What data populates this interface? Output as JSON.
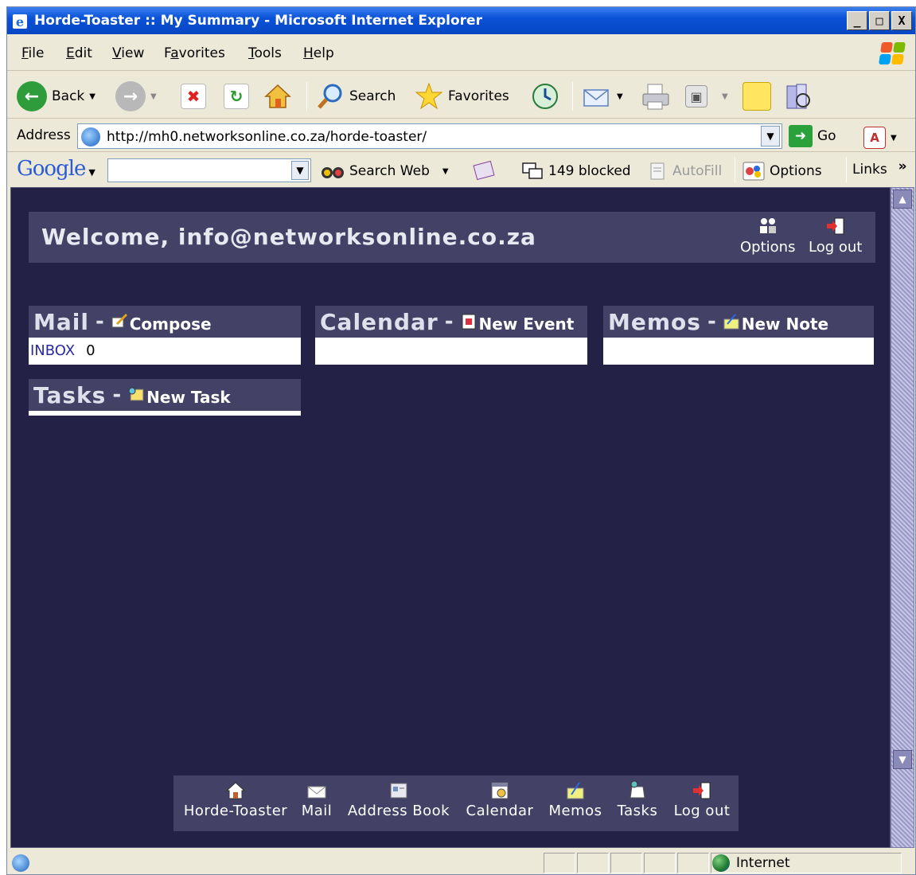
{
  "window": {
    "title": "Horde-Toaster :: My Summary - Microsoft Internet Explorer",
    "buttons": {
      "minimize": "_",
      "maximize": "□",
      "close": "X"
    }
  },
  "menubar": {
    "items": [
      {
        "label": "File",
        "accel": "F",
        "rest": "ile"
      },
      {
        "label": "Edit",
        "accel": "E",
        "rest": "dit"
      },
      {
        "label": "View",
        "accel": "V",
        "rest": "iew"
      },
      {
        "label": "Favorites",
        "pre": "F",
        "accel": "a",
        "rest": "vorites"
      },
      {
        "label": "Tools",
        "accel": "T",
        "rest": "ools"
      },
      {
        "label": "Help",
        "accel": "H",
        "rest": "elp"
      }
    ]
  },
  "toolbar": {
    "back_label": "Back",
    "search_label": "Search",
    "favorites_label": "Favorites"
  },
  "addressbar": {
    "label": "Address",
    "url": "http://mh0.networksonline.co.za/horde-toaster/",
    "go_label": "Go"
  },
  "googlebar": {
    "logo": "Google",
    "search_value": "",
    "search_web_label": "Search Web",
    "blocked_label": "149 blocked",
    "autofill_label": "AutoFill",
    "options_label": "Options",
    "links_label": "Links"
  },
  "page": {
    "welcome_text": "Welcome, info@networksonline.co.za",
    "options_label": "Options",
    "logout_label": "Log out",
    "panels": {
      "mail": {
        "name": "Mail",
        "action": "Compose",
        "inbox_label": "INBOX",
        "inbox_count": "0"
      },
      "calendar": {
        "name": "Calendar",
        "action": "New Event"
      },
      "memos": {
        "name": "Memos",
        "action": "New Note"
      },
      "tasks": {
        "name": "Tasks",
        "action": "New Task"
      }
    },
    "dash": "-",
    "bottom_nav": [
      {
        "label": "Horde-Toaster",
        "icon": "home-icon"
      },
      {
        "label": "Mail",
        "icon": "envelope-icon"
      },
      {
        "label": "Address Book",
        "icon": "address-book-icon"
      },
      {
        "label": "Calendar",
        "icon": "calendar-icon"
      },
      {
        "label": "Memos",
        "icon": "memo-icon"
      },
      {
        "label": "Tasks",
        "icon": "tasks-icon"
      },
      {
        "label": "Log out",
        "icon": "logout-icon"
      }
    ]
  },
  "statusbar": {
    "zone": "Internet"
  },
  "colors": {
    "page_bg": "#232146",
    "header_bg": "#434266",
    "titlebar": "#0a52d8",
    "inbox_link": "#2a2aa0"
  }
}
